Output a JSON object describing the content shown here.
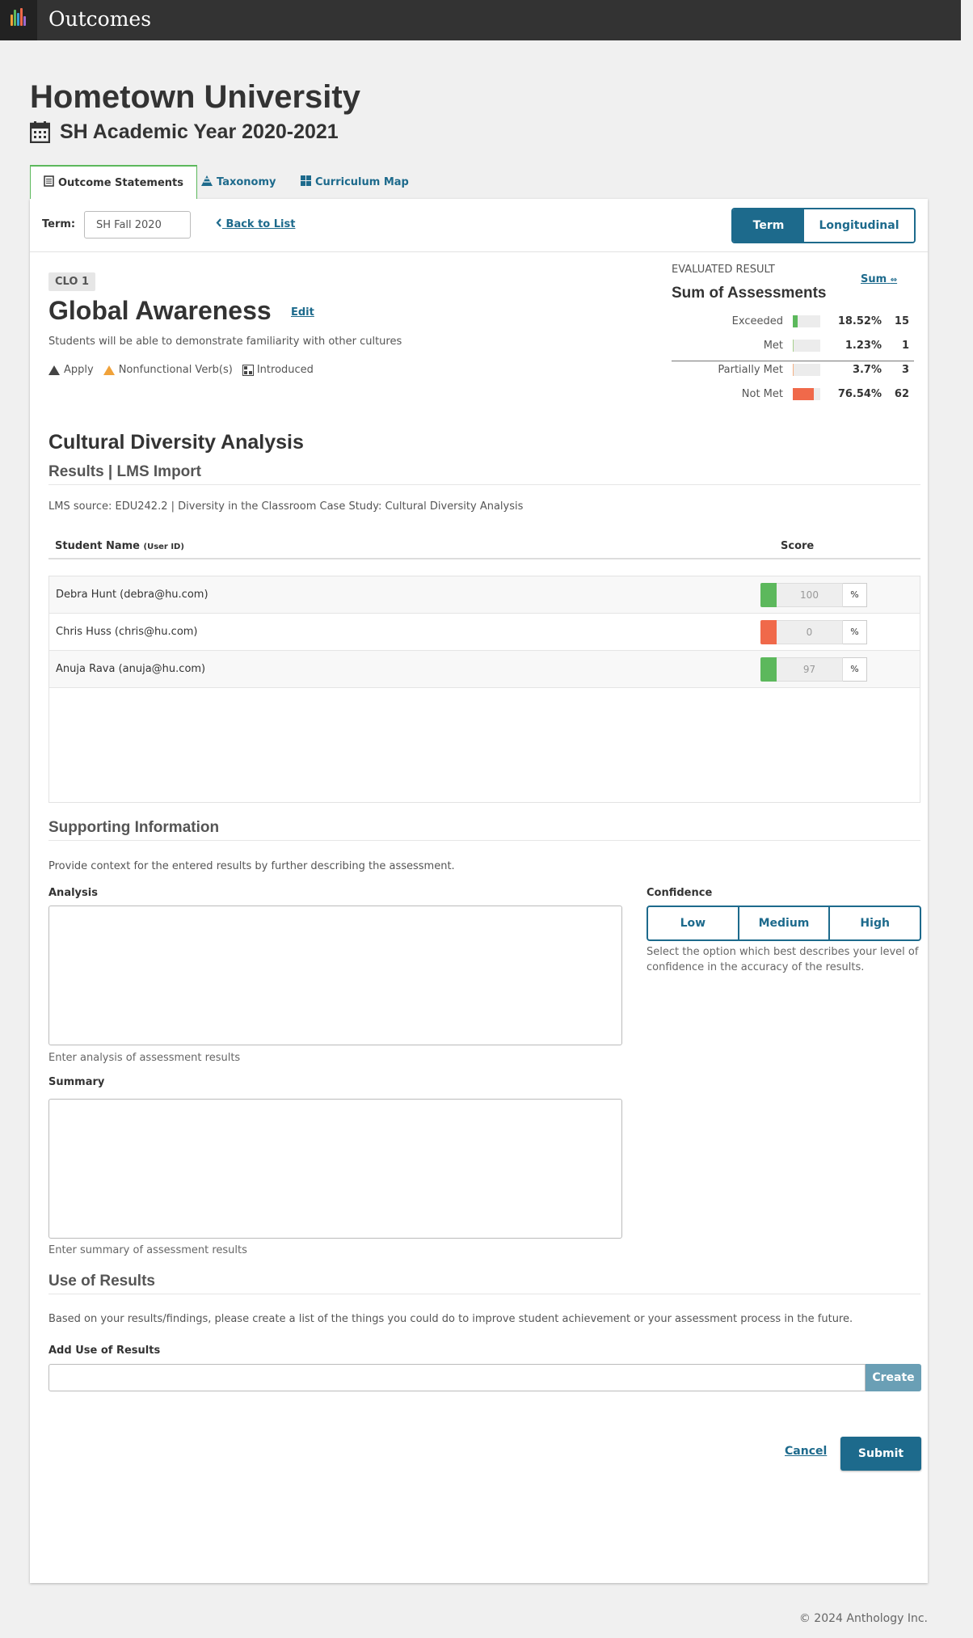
{
  "app": {
    "title": "Outcomes"
  },
  "header": {
    "institution": "Hometown University",
    "academic_year": "SH Academic Year 2020-2021"
  },
  "tabs": [
    {
      "label": "Outcome Statements",
      "active": true
    },
    {
      "label": "Taxonomy",
      "active": false
    },
    {
      "label": "Curriculum Map",
      "active": false
    }
  ],
  "toolbar": {
    "term_label": "Term:",
    "term_value": "SH Fall 2020",
    "back_label": "Back to List",
    "view_term": "Term",
    "view_longitudinal": "Longitudinal"
  },
  "outcome": {
    "badge": "CLO 1",
    "title": "Global Awareness",
    "edit_label": "Edit",
    "description": "Students will be able to demonstrate familiarity with other cultures",
    "tags": [
      "Apply",
      "Nonfunctional Verb(s)",
      "Introduced"
    ]
  },
  "evaluated": {
    "label": "EVALUATED RESULT",
    "method_link": "Sum",
    "title": "Sum of Assessments",
    "rows": [
      {
        "name": "Exceeded",
        "percent": "18.52%",
        "fraction": 0.1852,
        "count": "15",
        "color": "#5cb85c"
      },
      {
        "name": "Met",
        "percent": "1.23%",
        "fraction": 0.0123,
        "count": "1",
        "color": "#a8d08d"
      },
      {
        "name": "Partially Met",
        "percent": "3.7%",
        "fraction": 0.037,
        "count": "3",
        "color": "#f5b083"
      },
      {
        "name": "Not Met",
        "percent": "76.54%",
        "fraction": 0.7654,
        "count": "62",
        "color": "#f0694a"
      }
    ]
  },
  "assessment": {
    "title": "Cultural Diversity Analysis",
    "results_heading": "Results | LMS Import",
    "lms_source": "LMS source: EDU242.2 | Diversity in the Classroom Case Study: Cultural Diversity Analysis",
    "col_name": "Student Name",
    "col_name_sub": "(User ID)",
    "col_score": "Score",
    "students": [
      {
        "name": "Debra Hunt (debra@hu.com)",
        "score": "100",
        "unit": "%",
        "color": "#5cb85c"
      },
      {
        "name": "Chris Huss (chris@hu.com)",
        "score": "0",
        "unit": "%",
        "color": "#f0694a"
      },
      {
        "name": "Anuja Rava (anuja@hu.com)",
        "score": "97",
        "unit": "%",
        "color": "#5cb85c"
      }
    ]
  },
  "supporting": {
    "heading": "Supporting Information",
    "intro": "Provide context for the entered results by further describing the assessment.",
    "analysis_label": "Analysis",
    "analysis_help": "Enter analysis of assessment results",
    "summary_label": "Summary",
    "summary_help": "Enter summary of assessment results",
    "confidence_label": "Confidence",
    "confidence_options": [
      "Low",
      "Medium",
      "High"
    ],
    "confidence_help": "Select the option which best describes your level of confidence in the accuracy of the results."
  },
  "use_of_results": {
    "heading": "Use of Results",
    "intro": "Based on your results/findings, please create a list of the things you could do to improve student achievement or your assessment process in the future.",
    "add_label": "Add Use of Results",
    "create_label": "Create"
  },
  "actions": {
    "cancel": "Cancel",
    "submit": "Submit"
  },
  "footer": {
    "copyright": "© 2024 Anthology Inc."
  }
}
